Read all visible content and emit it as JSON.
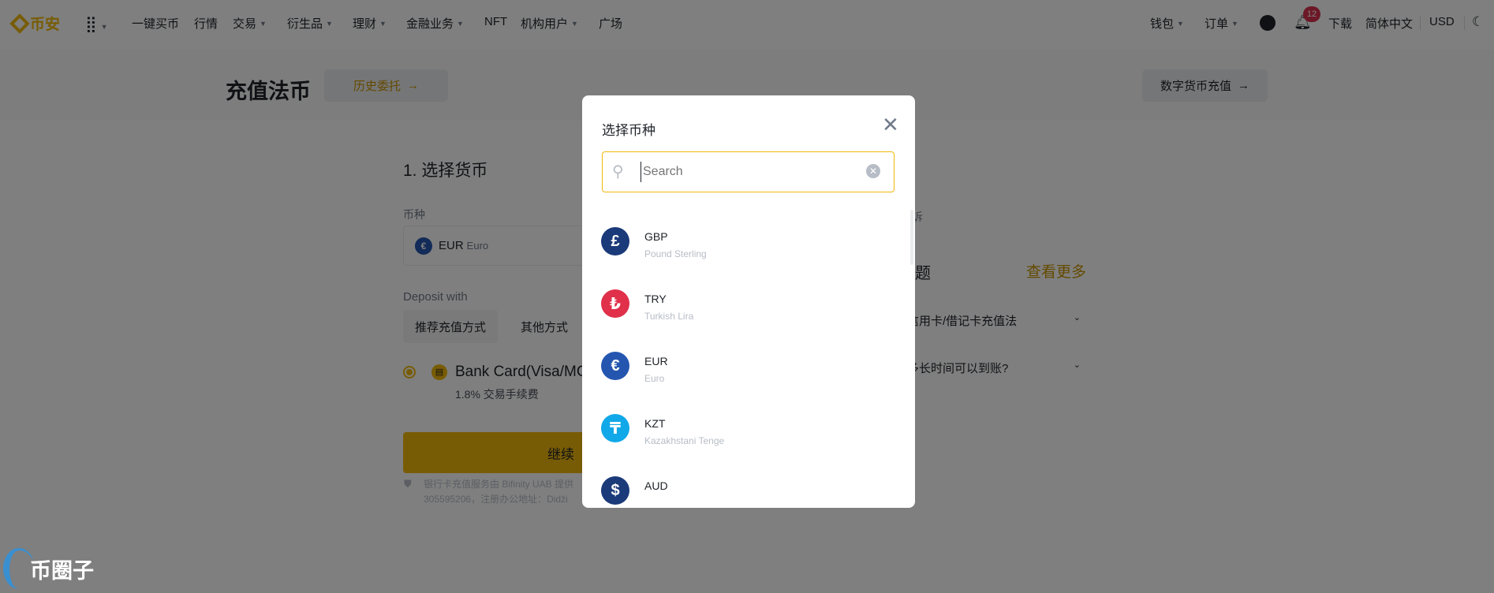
{
  "header": {
    "logo_text": "币安",
    "nav": [
      {
        "label": "一键买币",
        "caret": false
      },
      {
        "label": "行情",
        "caret": false
      },
      {
        "label": "交易",
        "caret": true
      },
      {
        "label": "衍生品",
        "caret": true
      },
      {
        "label": "理财",
        "caret": true
      },
      {
        "label": "金融业务",
        "caret": true
      },
      {
        "label": "NFT",
        "caret": false
      },
      {
        "label": "机构用户",
        "caret": true
      },
      {
        "label": "广场",
        "caret": false
      }
    ],
    "wallet": "钱包",
    "orders": "订单",
    "notification_count": "12",
    "download": "下载",
    "language": "简体中文",
    "currency": "USD"
  },
  "page": {
    "title": "充值法币",
    "history_button": "历史委托",
    "crypto_deposit_button": "数字货币充值",
    "step_title": "1. 选择货币",
    "currency_label": "币种",
    "selected_code": "EUR",
    "selected_name": "Euro",
    "deposit_with": "Deposit with",
    "tabs": [
      "推荐充值方式",
      "其他方式"
    ],
    "method_name": "Bank Card(Visa/MC)",
    "method_fee": "1.8% 交易手续费",
    "continue_button": "继续",
    "footnote_line1": "银行卡充值服务由 Bifinity UAB 提供",
    "footnote_line2": "305595206，注册办公地址：Didži",
    "side_partial": "诉",
    "faq_title": "问题",
    "faq_more": "查看更多",
    "faq_items": [
      "使用信用卡/借记卡充值法",
      "需要多长时间可以到账?"
    ]
  },
  "modal": {
    "title": "选择币种",
    "search_placeholder": "Search",
    "currencies": [
      {
        "code": "GBP",
        "name": "Pound Sterling",
        "symbol": "£",
        "color": "#1B3A7A"
      },
      {
        "code": "TRY",
        "name": "Turkish Lira",
        "symbol": "₺",
        "color": "#E0304A"
      },
      {
        "code": "EUR",
        "name": "Euro",
        "symbol": "€",
        "color": "#2456B0"
      },
      {
        "code": "KZT",
        "name": "Kazakhstani Tenge",
        "symbol": "₸",
        "color": "#10A8E8"
      },
      {
        "code": "AUD",
        "name": "",
        "symbol": "$",
        "color": "#1B3A7A"
      }
    ]
  },
  "watermark": "币圈子",
  "colors": {
    "brand": "#F0B90B",
    "text": "#1E2329",
    "muted": "#707A8A"
  }
}
